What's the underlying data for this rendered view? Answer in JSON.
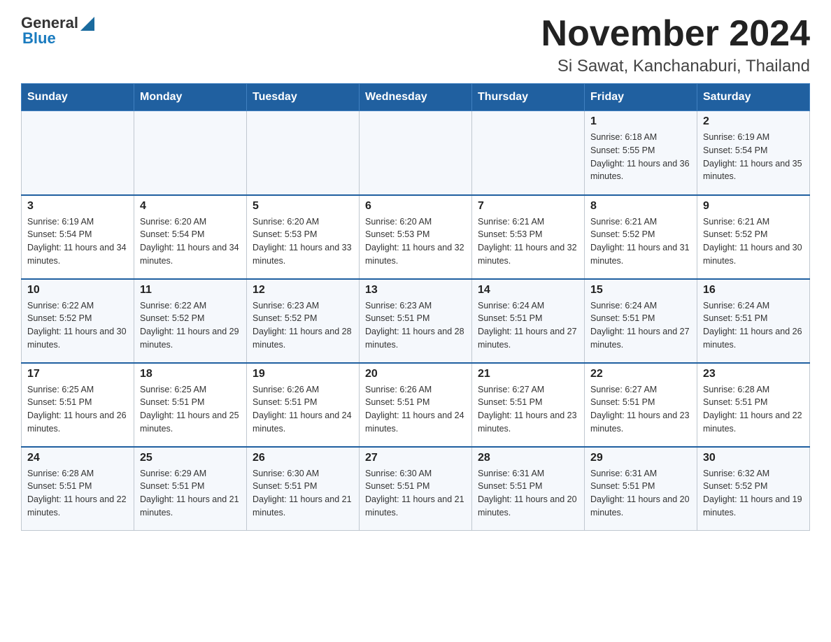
{
  "header": {
    "logo": {
      "general": "General",
      "blue": "Blue"
    },
    "month_title": "November 2024",
    "location": "Si Sawat, Kanchanaburi, Thailand"
  },
  "days_of_week": [
    "Sunday",
    "Monday",
    "Tuesday",
    "Wednesday",
    "Thursday",
    "Friday",
    "Saturday"
  ],
  "weeks": [
    [
      {
        "day": "",
        "info": ""
      },
      {
        "day": "",
        "info": ""
      },
      {
        "day": "",
        "info": ""
      },
      {
        "day": "",
        "info": ""
      },
      {
        "day": "",
        "info": ""
      },
      {
        "day": "1",
        "info": "Sunrise: 6:18 AM\nSunset: 5:55 PM\nDaylight: 11 hours and 36 minutes."
      },
      {
        "day": "2",
        "info": "Sunrise: 6:19 AM\nSunset: 5:54 PM\nDaylight: 11 hours and 35 minutes."
      }
    ],
    [
      {
        "day": "3",
        "info": "Sunrise: 6:19 AM\nSunset: 5:54 PM\nDaylight: 11 hours and 34 minutes."
      },
      {
        "day": "4",
        "info": "Sunrise: 6:20 AM\nSunset: 5:54 PM\nDaylight: 11 hours and 34 minutes."
      },
      {
        "day": "5",
        "info": "Sunrise: 6:20 AM\nSunset: 5:53 PM\nDaylight: 11 hours and 33 minutes."
      },
      {
        "day": "6",
        "info": "Sunrise: 6:20 AM\nSunset: 5:53 PM\nDaylight: 11 hours and 32 minutes."
      },
      {
        "day": "7",
        "info": "Sunrise: 6:21 AM\nSunset: 5:53 PM\nDaylight: 11 hours and 32 minutes."
      },
      {
        "day": "8",
        "info": "Sunrise: 6:21 AM\nSunset: 5:52 PM\nDaylight: 11 hours and 31 minutes."
      },
      {
        "day": "9",
        "info": "Sunrise: 6:21 AM\nSunset: 5:52 PM\nDaylight: 11 hours and 30 minutes."
      }
    ],
    [
      {
        "day": "10",
        "info": "Sunrise: 6:22 AM\nSunset: 5:52 PM\nDaylight: 11 hours and 30 minutes."
      },
      {
        "day": "11",
        "info": "Sunrise: 6:22 AM\nSunset: 5:52 PM\nDaylight: 11 hours and 29 minutes."
      },
      {
        "day": "12",
        "info": "Sunrise: 6:23 AM\nSunset: 5:52 PM\nDaylight: 11 hours and 28 minutes."
      },
      {
        "day": "13",
        "info": "Sunrise: 6:23 AM\nSunset: 5:51 PM\nDaylight: 11 hours and 28 minutes."
      },
      {
        "day": "14",
        "info": "Sunrise: 6:24 AM\nSunset: 5:51 PM\nDaylight: 11 hours and 27 minutes."
      },
      {
        "day": "15",
        "info": "Sunrise: 6:24 AM\nSunset: 5:51 PM\nDaylight: 11 hours and 27 minutes."
      },
      {
        "day": "16",
        "info": "Sunrise: 6:24 AM\nSunset: 5:51 PM\nDaylight: 11 hours and 26 minutes."
      }
    ],
    [
      {
        "day": "17",
        "info": "Sunrise: 6:25 AM\nSunset: 5:51 PM\nDaylight: 11 hours and 26 minutes."
      },
      {
        "day": "18",
        "info": "Sunrise: 6:25 AM\nSunset: 5:51 PM\nDaylight: 11 hours and 25 minutes."
      },
      {
        "day": "19",
        "info": "Sunrise: 6:26 AM\nSunset: 5:51 PM\nDaylight: 11 hours and 24 minutes."
      },
      {
        "day": "20",
        "info": "Sunrise: 6:26 AM\nSunset: 5:51 PM\nDaylight: 11 hours and 24 minutes."
      },
      {
        "day": "21",
        "info": "Sunrise: 6:27 AM\nSunset: 5:51 PM\nDaylight: 11 hours and 23 minutes."
      },
      {
        "day": "22",
        "info": "Sunrise: 6:27 AM\nSunset: 5:51 PM\nDaylight: 11 hours and 23 minutes."
      },
      {
        "day": "23",
        "info": "Sunrise: 6:28 AM\nSunset: 5:51 PM\nDaylight: 11 hours and 22 minutes."
      }
    ],
    [
      {
        "day": "24",
        "info": "Sunrise: 6:28 AM\nSunset: 5:51 PM\nDaylight: 11 hours and 22 minutes."
      },
      {
        "day": "25",
        "info": "Sunrise: 6:29 AM\nSunset: 5:51 PM\nDaylight: 11 hours and 21 minutes."
      },
      {
        "day": "26",
        "info": "Sunrise: 6:30 AM\nSunset: 5:51 PM\nDaylight: 11 hours and 21 minutes."
      },
      {
        "day": "27",
        "info": "Sunrise: 6:30 AM\nSunset: 5:51 PM\nDaylight: 11 hours and 21 minutes."
      },
      {
        "day": "28",
        "info": "Sunrise: 6:31 AM\nSunset: 5:51 PM\nDaylight: 11 hours and 20 minutes."
      },
      {
        "day": "29",
        "info": "Sunrise: 6:31 AM\nSunset: 5:51 PM\nDaylight: 11 hours and 20 minutes."
      },
      {
        "day": "30",
        "info": "Sunrise: 6:32 AM\nSunset: 5:52 PM\nDaylight: 11 hours and 19 minutes."
      }
    ]
  ]
}
